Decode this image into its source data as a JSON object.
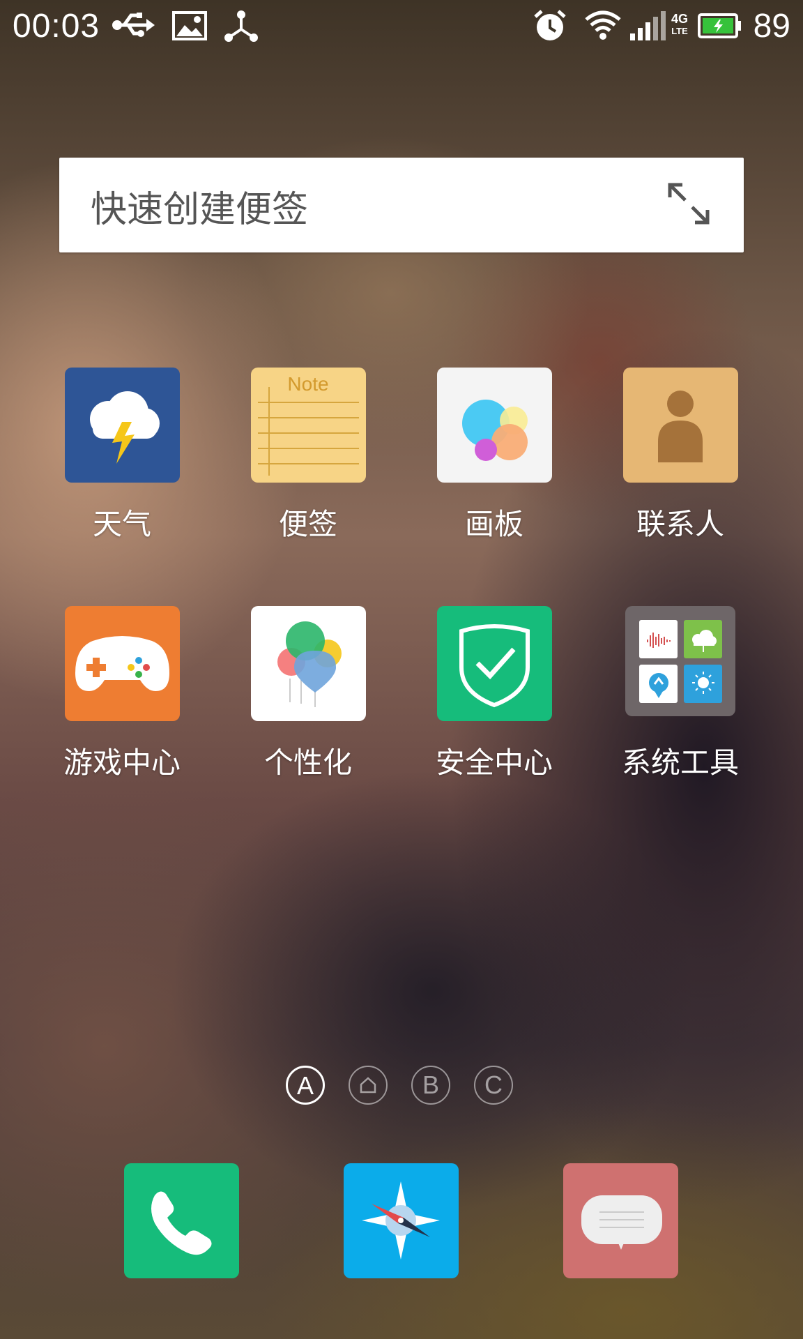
{
  "status_bar": {
    "time": "00:03",
    "left_icons": [
      "usb-icon",
      "image-icon",
      "share-network-icon"
    ],
    "right_icons": [
      "alarm-icon",
      "wifi-icon",
      "signal-icon",
      "battery-charging-icon"
    ],
    "network_type_top": "4G",
    "network_type_bottom": "LTE",
    "battery_percent": "89"
  },
  "note_widget": {
    "placeholder": "快速创建便签",
    "icon": "expand-icon"
  },
  "apps": [
    {
      "label": "天气",
      "icon": "weather-icon",
      "color": "#2e5596"
    },
    {
      "label": "便签",
      "icon": "notes-icon",
      "color": "#f7d486",
      "icon_text": "Note"
    },
    {
      "label": "画板",
      "icon": "palette-icon",
      "color": "#f4f4f4"
    },
    {
      "label": "联系人",
      "icon": "contacts-icon",
      "color": "#e6b774"
    },
    {
      "label": "游戏中心",
      "icon": "gamepad-icon",
      "color": "#ee7d32"
    },
    {
      "label": "个性化",
      "icon": "balloons-icon",
      "color": "#ffffff"
    },
    {
      "label": "安全中心",
      "icon": "shield-check-icon",
      "color": "#16bc7b"
    },
    {
      "label": "系统工具",
      "icon": "folder-icon",
      "color": "#6e6668"
    }
  ],
  "page_indicator": {
    "pages": [
      "A",
      "home",
      "B",
      "C"
    ],
    "active_index": 0
  },
  "dock": [
    {
      "name": "phone",
      "icon": "phone-icon",
      "color": "#16bc7b"
    },
    {
      "name": "browser",
      "icon": "compass-icon",
      "color": "#0bacea"
    },
    {
      "name": "messages",
      "icon": "message-bubble-icon",
      "color": "#cf7170"
    }
  ]
}
